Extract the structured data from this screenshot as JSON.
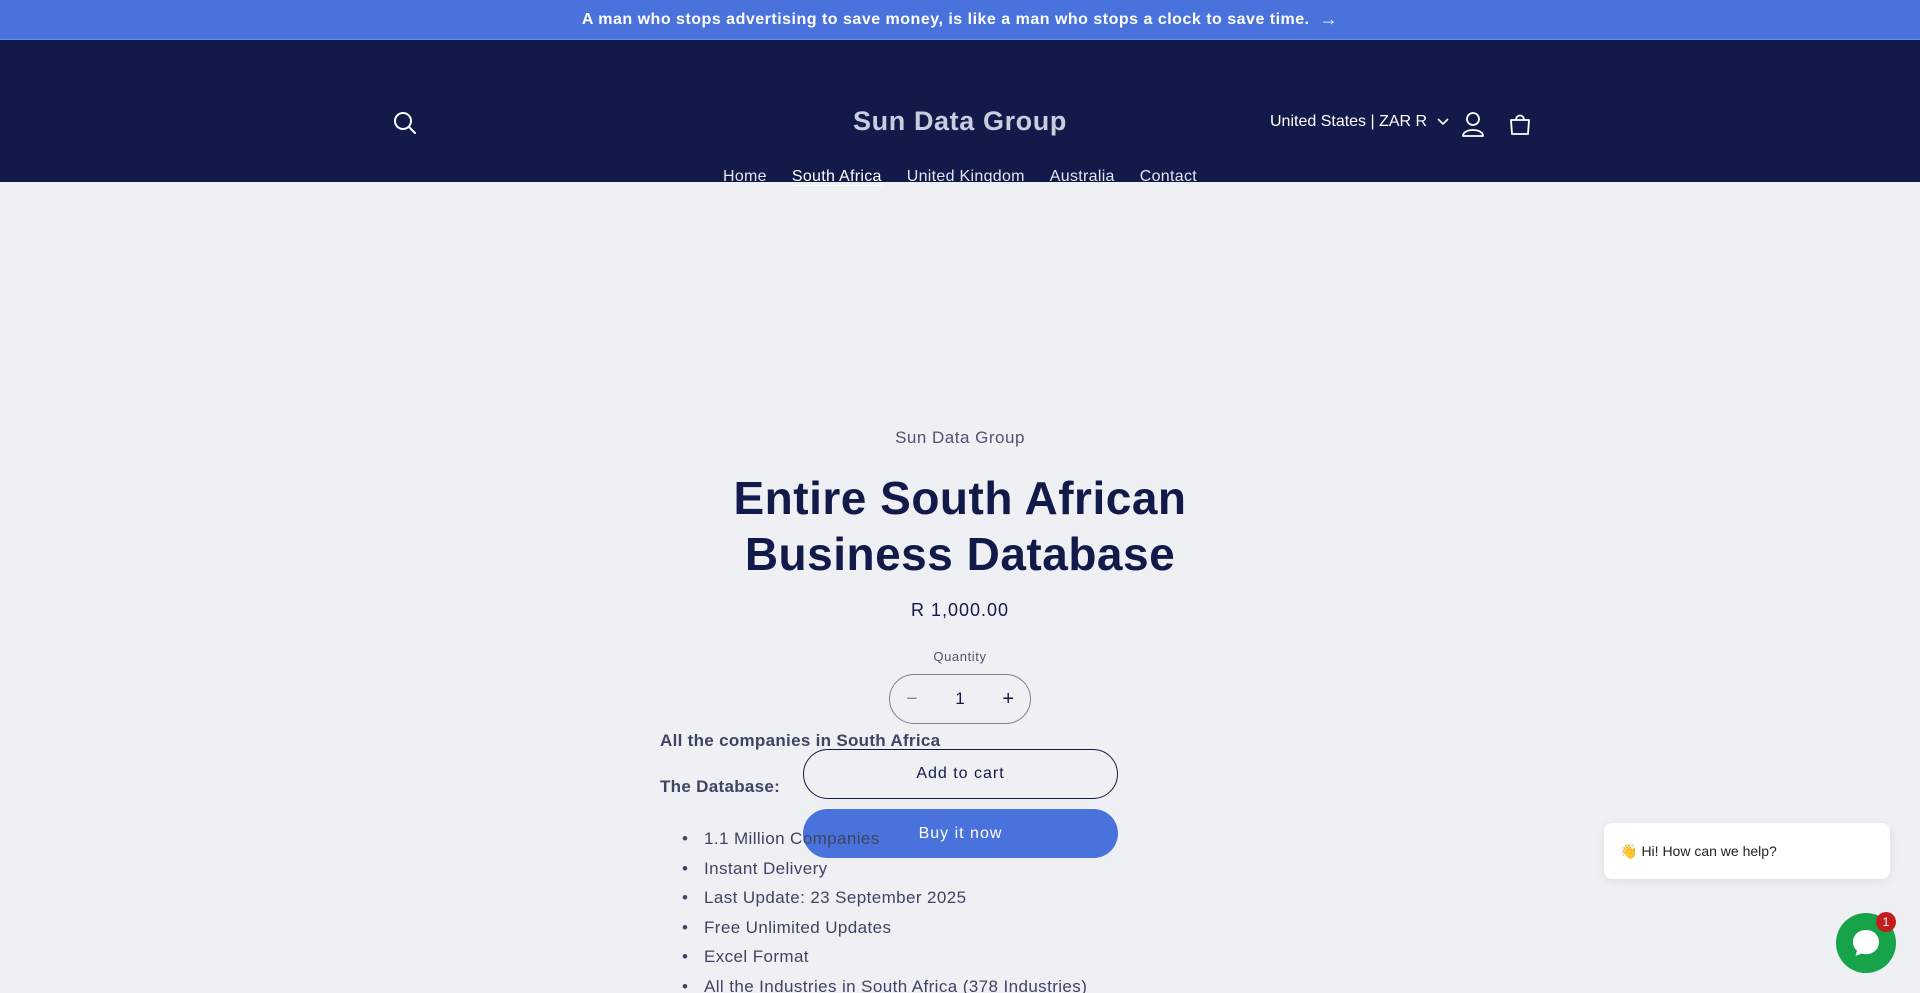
{
  "announcement": {
    "text": "A man who stops advertising to save money, is like a man who stops a clock to save time.",
    "arrow": "→"
  },
  "header": {
    "brand": "Sun Data Group",
    "locale": "United States | ZAR R",
    "nav": [
      {
        "label": "Home"
      },
      {
        "label": "South Africa",
        "active": true
      },
      {
        "label": "United Kingdom"
      },
      {
        "label": "Australia"
      },
      {
        "label": "Contact"
      }
    ],
    "icons": {
      "search": "search-icon",
      "account": "user-icon",
      "cart": "cart-icon",
      "locale_caret": "chevron-down-icon"
    }
  },
  "product": {
    "vendor": "Sun Data Group",
    "title_line1": "Entire South African",
    "title_line2": "Business Database",
    "price": "R 1,000.00",
    "quantity_label": "Quantity",
    "quantity_value": "1",
    "minus": "−",
    "plus": "+",
    "add_to_cart": "Add to cart",
    "buy_now": "Buy it now"
  },
  "description": {
    "heading1": "All the companies in South Africa",
    "heading2": "The Database:",
    "bullets": [
      "1.1 Million Companies",
      "Instant Delivery",
      "Last Update: 23 September 2025",
      "Free Unlimited Updates",
      "Excel Format",
      "All the Industries in South Africa (378 Industries)"
    ]
  },
  "chat": {
    "greeting_emoji": "👋",
    "greeting": "Hi! How can we help?",
    "badge": "1"
  },
  "colors": {
    "announcement_bg": "#4a72dc",
    "header_bg": "#121a4a",
    "page_bg": "#eef0f4",
    "accent": "#4a72dc",
    "chat_green": "#16a34a",
    "badge_red": "#c31d1d"
  }
}
